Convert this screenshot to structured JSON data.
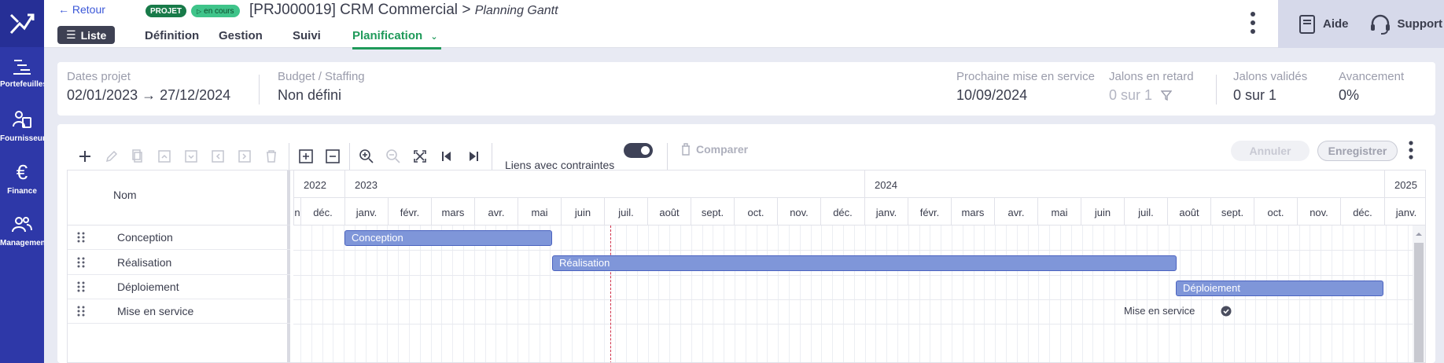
{
  "rail": {
    "items": [
      {
        "label": "Portefeuilles",
        "icon": "portfolio-gantt-icon"
      },
      {
        "label": "Fournisseurs",
        "icon": "suppliers-icon"
      },
      {
        "label": "Finance",
        "icon": "euro-icon"
      },
      {
        "label": "Management",
        "icon": "team-icon"
      }
    ]
  },
  "header": {
    "back_label": "Retour",
    "list_label": "Liste",
    "badge_type": "PROJET",
    "badge_status": "en cours",
    "title": "[PRJ000019] CRM Commercial",
    "separator": ">",
    "subtitle": "Planning Gantt",
    "tabs": [
      {
        "label": "Définition"
      },
      {
        "label": "Gestion"
      },
      {
        "label": "Suivi"
      },
      {
        "label": "Planification",
        "active": true
      }
    ],
    "help_label": "Aide",
    "support_label": "Support"
  },
  "kpi": {
    "dates_label": "Dates projet",
    "dates_value": "02/01/2023 → 27/12/2024",
    "budget_label": "Budget / Staffing",
    "budget_value": "Non défini",
    "next_label": "Prochaine mise en service",
    "next_value": "10/09/2024",
    "late_label": "Jalons en retard",
    "late_value": "0 sur 1",
    "validated_label": "Jalons validés",
    "validated_value": "0 sur 1",
    "progress_label": "Avancement",
    "progress_value": "0%"
  },
  "toolbar": {
    "links_label": "Liens avec contraintes",
    "links_enabled": true,
    "compare_label": "Comparer",
    "cancel_label": "Annuler",
    "save_label": "Enregistrer"
  },
  "gantt": {
    "name_header": "Nom",
    "years": [
      "2022",
      "2023",
      "2024",
      "2025"
    ],
    "months_2022": [
      "n",
      "déc."
    ],
    "months": [
      "janv.",
      "févr.",
      "mars",
      "avr.",
      "mai",
      "juin",
      "juil.",
      "août",
      "sept.",
      "oct.",
      "nov.",
      "déc."
    ],
    "months_2025": [
      "janv."
    ],
    "rows": [
      {
        "name": "Conception",
        "bar_label": "Conception"
      },
      {
        "name": "Réalisation",
        "bar_label": "Réalisation"
      },
      {
        "name": "Déploiement",
        "bar_label": "Déploiement"
      },
      {
        "name": "Mise en service",
        "milestone_label": "Mise en service"
      }
    ]
  },
  "colors": {
    "rail": "#2e38a8",
    "accent_green": "#1f9a5a",
    "bar": "#7f96d9",
    "today_line": "#d0304a"
  }
}
